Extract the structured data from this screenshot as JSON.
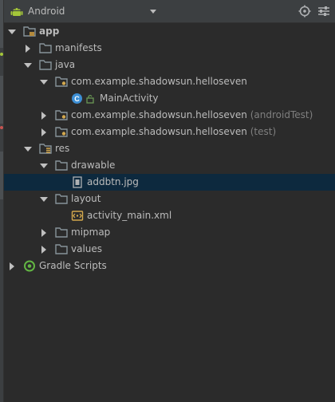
{
  "toolbar": {
    "view_label": "Android",
    "icons": [
      "android-icon",
      "chevron-down-icon",
      "target-icon",
      "settings-sliders-icon"
    ]
  },
  "tree": {
    "app": "app",
    "manifests": "manifests",
    "java": "java",
    "pkg_main": "com.example.shadowsun.helloseven",
    "main_activity": "MainActivity",
    "pkg_android_test": "com.example.shadowsun.helloseven",
    "pkg_android_test_suffix": "(androidTest)",
    "pkg_test": "com.example.shadowsun.helloseven",
    "pkg_test_suffix": "(test)",
    "res": "res",
    "drawable": "drawable",
    "addbtn": "addbtn.jpg",
    "layout": "layout",
    "activity_main": "activity_main.xml",
    "mipmap": "mipmap",
    "values": "values",
    "gradle": "Gradle Scripts"
  },
  "colors": {
    "background": "#2b2b2b",
    "toolbar": "#3c3f41",
    "selection": "#0d293e",
    "folder": "#87939a",
    "android_green": "#a4c639",
    "class_badge": "#3d8fd4"
  }
}
